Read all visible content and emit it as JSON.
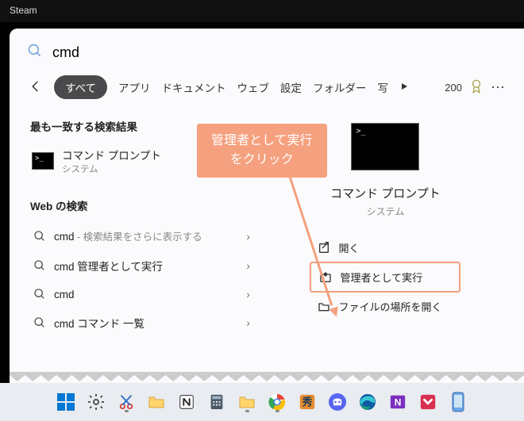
{
  "bg_app_title": "Steam",
  "search": {
    "query": "cmd"
  },
  "tabs": {
    "all": "すべて",
    "apps": "アプリ",
    "documents": "ドキュメント",
    "web": "ウェブ",
    "settings": "設定",
    "folders": "フォルダー",
    "photos": "写",
    "score": "200"
  },
  "sections": {
    "best_match": "最も一致する検索結果",
    "web_search": "Web の検索"
  },
  "best": {
    "title": "コマンド プロンプト",
    "subtitle": "システム"
  },
  "web_results": [
    {
      "term": "cmd",
      "suffix": " - 検索結果をさらに表示する"
    },
    {
      "term": "cmd 管理者として実行",
      "suffix": ""
    },
    {
      "term": "cmd",
      "suffix": ""
    },
    {
      "term": "cmd コマンド 一覧",
      "suffix": ""
    }
  ],
  "preview": {
    "title": "コマンド プロンプト",
    "subtitle": "システム",
    "actions": {
      "open": "開く",
      "run_admin": "管理者として実行",
      "open_location": "ファイルの場所を開く"
    }
  },
  "annotation": {
    "line1": "管理者として実行",
    "line2": "をクリック"
  },
  "taskbar_icons": [
    "start",
    "settings",
    "snipping-tool",
    "file-explorer",
    "notion",
    "calculator",
    "file-explorer-2",
    "chrome",
    "app-orange",
    "discord",
    "edge",
    "onenote",
    "pocket",
    "phone"
  ]
}
